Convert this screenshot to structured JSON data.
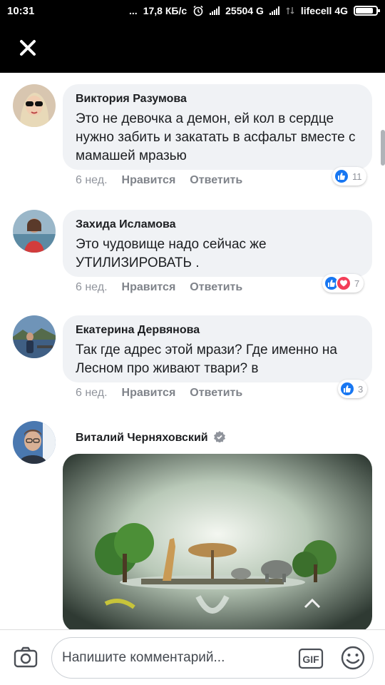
{
  "status_bar": {
    "time": "10:31",
    "dots": "...",
    "speed": "17,8 КБ/с",
    "signal_count": "25504 G",
    "carrier": "lifecell 4G",
    "battery_percent": 85
  },
  "header": {
    "close_icon": "close-icon"
  },
  "comments": [
    {
      "author": "Виктория Разумова",
      "text": "Это не девочка а демон, ей кол в сердце нужно забить и закатать в асфальт вместе с мамашей мразью",
      "time": "6 нед.",
      "like_label": "Нравится",
      "reply_label": "Ответить",
      "reaction_count": "11"
    },
    {
      "author": "Захида Исламова",
      "text": "Это чудовище надо сейчас же УТИЛИЗИРОВАТЬ .",
      "time": "6 нед.",
      "like_label": "Нравится",
      "reply_label": "Ответить",
      "reaction_count": "7"
    },
    {
      "author": "Екатерина Дервянова",
      "text": "Так где адрес этой мрази? Где именно на Лесном про живают твари? в",
      "time": "6 нед.",
      "like_label": "Нравится",
      "reply_label": "Ответить",
      "reaction_count": "3"
    },
    {
      "author": "Виталий Черняховский"
    }
  ],
  "composer": {
    "placeholder": "Напишите комментарий...",
    "gif_label": "GIF"
  },
  "colors": {
    "like_blue": "#1877f2",
    "love_red": "#f33e58",
    "bubble_bg": "#f0f2f5"
  }
}
